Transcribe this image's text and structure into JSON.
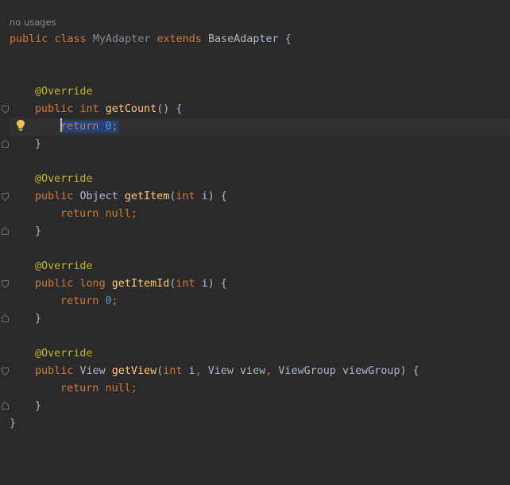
{
  "hint": "no usages",
  "class_decl": {
    "kw_public": "public",
    "kw_class": "class",
    "name": "MyAdapter",
    "kw_extends": "extends",
    "parent": "BaseAdapter",
    "open": "{",
    "close": "}"
  },
  "methods": [
    {
      "annotation": "@Override",
      "kw_public": "public",
      "ret_type": "int",
      "name": "getCount",
      "params_open": "(",
      "params": "",
      "params_close": ") {",
      "body_kw": "return",
      "body_val": "0",
      "body_end": ";",
      "close": "}"
    },
    {
      "annotation": "@Override",
      "kw_public": "public",
      "ret_type": "Object",
      "name": "getItem",
      "p1_type": "int",
      "p1_name": "i",
      "body_kw": "return",
      "body_val": "null",
      "body_end": ";",
      "close": "}"
    },
    {
      "annotation": "@Override",
      "kw_public": "public",
      "ret_type": "long",
      "name": "getItemId",
      "p1_type": "int",
      "p1_name": "i",
      "body_kw": "return",
      "body_val": "0",
      "body_end": ";",
      "close": "}"
    },
    {
      "annotation": "@Override",
      "kw_public": "public",
      "ret_type": "View",
      "name": "getView",
      "p1_type": "int",
      "p1_name": "i",
      "p2_type": "View",
      "p2_name": "view",
      "p3_type": "ViewGroup",
      "p3_name": "viewGroup",
      "body_kw": "return",
      "body_val": "null",
      "body_end": ";",
      "close": "}"
    }
  ],
  "colors": {
    "background": "#2b2b2b",
    "current_line": "#323232",
    "selection": "#214283",
    "keyword": "#cc7832",
    "annotation": "#bbb529",
    "method": "#ffc66d",
    "number": "#6897bb",
    "text": "#a9b7c6"
  },
  "icons": {
    "intention": "lightbulb-icon",
    "fold": "fold-marker-icon"
  }
}
